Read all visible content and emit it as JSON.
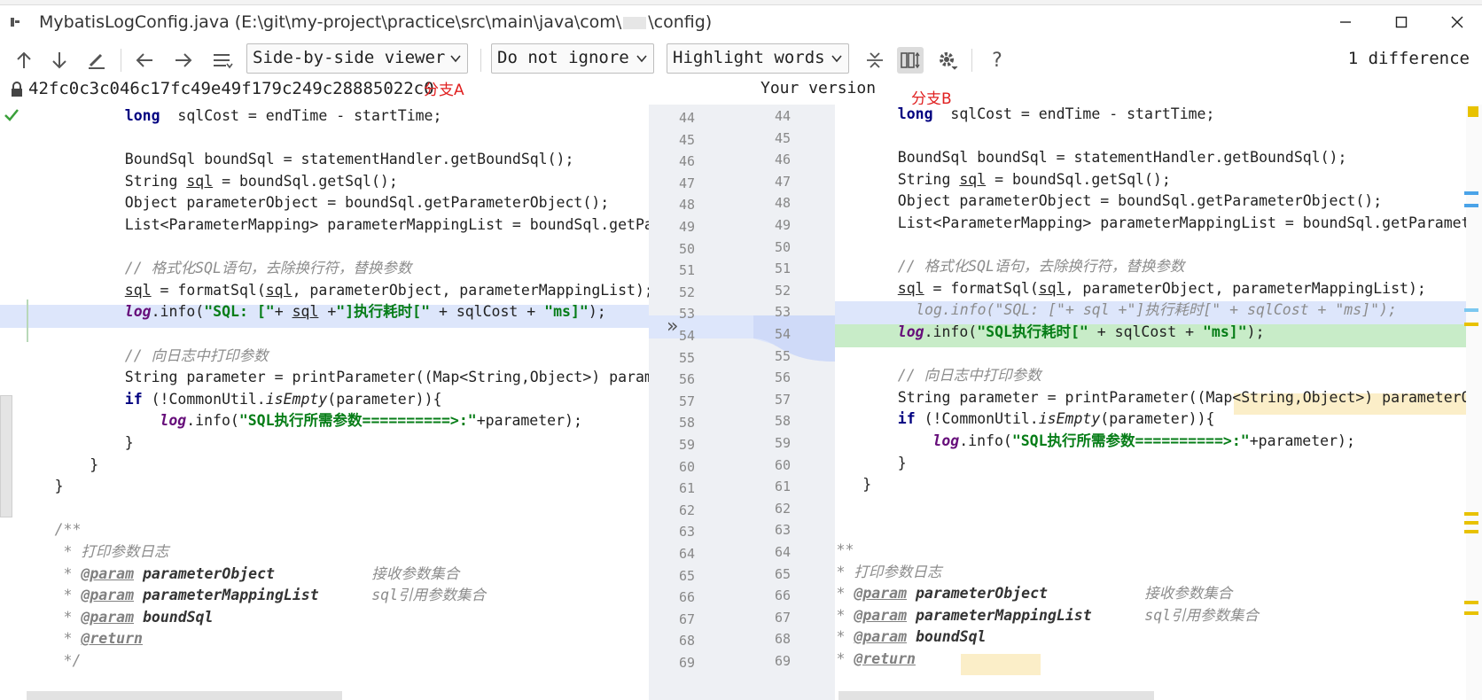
{
  "window": {
    "title": "MybatisLogConfig.java (E:\\git\\my-project\\practice\\src\\main\\java\\com\\",
    "title_tail": "\\config)",
    "minimize": "─",
    "maximize": "☐",
    "close": "✕"
  },
  "toolbar": {
    "viewer_mode": "Side-by-side viewer",
    "ignore_mode": "Do not ignore",
    "highlight_mode": "Highlight words",
    "help": "?",
    "difference_count": "1 difference"
  },
  "header": {
    "left_revision": "42fc0c3c046c17fc49e49f179c249c28885022c0",
    "left_annotation": "分支A",
    "right_title": "Your version",
    "right_annotation": "分支B"
  },
  "gutter_arrow": "»",
  "left_lines": [
    {
      "num": "44",
      "segs": [
        [
          "kw",
          "long"
        ],
        [
          "",
          "  sqlCost = endTime - startTime;"
        ]
      ],
      "ind": 12
    },
    {
      "num": "45",
      "segs": [],
      "ind": 12
    },
    {
      "num": "46",
      "segs": [
        [
          "",
          "BoundSql boundSql = statementHandler.getBoundSql();"
        ]
      ],
      "ind": 12
    },
    {
      "num": "47",
      "segs": [
        [
          "",
          "String "
        ],
        [
          "ul",
          "sql"
        ],
        [
          "",
          " = boundSql.getSql();"
        ]
      ],
      "ind": 12
    },
    {
      "num": "48",
      "segs": [
        [
          "",
          "Object parameterObject = boundSql.getParameterObject();"
        ]
      ],
      "ind": 12
    },
    {
      "num": "49",
      "segs": [
        [
          "",
          "List<ParameterMapping> parameterMappingList = boundSql.getParameterMappings();"
        ]
      ],
      "ind": 12
    },
    {
      "num": "50",
      "segs": [],
      "ind": 12
    },
    {
      "num": "51",
      "segs": [
        [
          "cm",
          "// 格式化SQL语句，去除换行符，替换参数"
        ]
      ],
      "ind": 12
    },
    {
      "num": "52",
      "segs": [
        [
          "ul",
          "sql"
        ],
        [
          "",
          " = formatSql("
        ],
        [
          "ul",
          "sql"
        ],
        [
          "",
          ", parameterObject, parameterMappingList);"
        ]
      ],
      "ind": 12
    },
    {
      "num": "53",
      "segs": [
        [
          "lg",
          "log"
        ],
        [
          "",
          ".info("
        ],
        [
          "str",
          "\"SQL: [\""
        ],
        [
          "",
          "+ "
        ],
        [
          "ul",
          "sql"
        ],
        [
          "",
          " +"
        ],
        [
          "str",
          "\"]执行耗时[\""
        ],
        [
          "",
          " + sqlCost + "
        ],
        [
          "str",
          "\"ms]\""
        ],
        [
          "",
          ");"
        ]
      ],
      "ind": 12
    },
    {
      "num": "54",
      "segs": [],
      "ind": 12
    },
    {
      "num": "55",
      "segs": [
        [
          "cm",
          "// 向日志中打印参数"
        ]
      ],
      "ind": 12
    },
    {
      "num": "56",
      "segs": [
        [
          "",
          "String parameter = printParameter((Map<String,Object>) parameterObject, parameterMappingList, boundSql);"
        ]
      ],
      "ind": 12
    },
    {
      "num": "57",
      "segs": [
        [
          "kw",
          "if"
        ],
        [
          "",
          " (!CommonUtil."
        ],
        [
          "st",
          "isEmpty"
        ],
        [
          "",
          "(parameter)){"
        ]
      ],
      "ind": 12
    },
    {
      "num": "58",
      "segs": [
        [
          "lg",
          "log"
        ],
        [
          "",
          ".info("
        ],
        [
          "str",
          "\"SQL执行所需参数==========>:\""
        ],
        [
          "",
          "+parameter);"
        ]
      ],
      "ind": 16
    },
    {
      "num": "59",
      "segs": [
        [
          "",
          "}"
        ]
      ],
      "ind": 12
    },
    {
      "num": "60",
      "segs": [
        [
          "",
          "}"
        ]
      ],
      "ind": 8
    },
    {
      "num": "61",
      "segs": [
        [
          "",
          "}"
        ]
      ],
      "ind": 4
    },
    {
      "num": "62",
      "segs": [],
      "ind": 4
    },
    {
      "num": "63",
      "segs": [
        [
          "cm",
          "/**"
        ]
      ],
      "ind": 4
    },
    {
      "num": "64",
      "segs": [
        [
          "cm",
          " * 打印参数日志"
        ]
      ],
      "ind": 4
    },
    {
      "num": "65",
      "segs": [
        [
          "cm",
          " * "
        ],
        [
          "tag",
          "@param"
        ],
        [
          "",
          " "
        ],
        [
          "pname",
          "parameterObject"
        ],
        [
          "cm",
          "           接收参数集合"
        ]
      ],
      "ind": 4
    },
    {
      "num": "66",
      "segs": [
        [
          "cm",
          " * "
        ],
        [
          "tag",
          "@param"
        ],
        [
          "",
          " "
        ],
        [
          "pname",
          "parameterMappingList"
        ],
        [
          "cm",
          "      sql引用参数集合"
        ]
      ],
      "ind": 4
    },
    {
      "num": "67",
      "segs": [
        [
          "cm",
          " * "
        ],
        [
          "tag",
          "@param"
        ],
        [
          "",
          " "
        ],
        [
          "pname",
          "boundSql"
        ]
      ],
      "ind": 4
    },
    {
      "num": "68",
      "segs": [
        [
          "cm",
          " * "
        ],
        [
          "tag",
          "@return"
        ]
      ],
      "ind": 4
    },
    {
      "num": "69",
      "segs": [
        [
          "cm",
          " */"
        ]
      ],
      "ind": 4
    }
  ],
  "right_lines": [
    {
      "num": "44",
      "segs": [
        [
          "kw",
          "long"
        ],
        [
          "",
          "  sqlCost = endTime - startTime;"
        ]
      ],
      "ind": 12
    },
    {
      "num": "45",
      "segs": [],
      "ind": 12
    },
    {
      "num": "46",
      "segs": [
        [
          "",
          "BoundSql boundSql = statementHandler.getBoundSql();"
        ]
      ],
      "ind": 12
    },
    {
      "num": "47",
      "segs": [
        [
          "",
          "String "
        ],
        [
          "ul",
          "sql"
        ],
        [
          "",
          " = boundSql.getSql();"
        ]
      ],
      "ind": 12
    },
    {
      "num": "48",
      "segs": [
        [
          "",
          "Object parameterObject = boundSql.getParameterObject();"
        ]
      ],
      "ind": 12
    },
    {
      "num": "49",
      "segs": [
        [
          "",
          "List<ParameterMapping> parameterMappingList = boundSql.getParameterMappings();"
        ]
      ],
      "ind": 12
    },
    {
      "num": "50",
      "segs": [],
      "ind": 12
    },
    {
      "num": "51",
      "segs": [
        [
          "cm",
          "// 格式化SQL语句，去除换行符，替换参数"
        ]
      ],
      "ind": 12
    },
    {
      "num": "52",
      "segs": [
        [
          "ul",
          "sql"
        ],
        [
          "",
          " = formatSql("
        ],
        [
          "ul",
          "sql"
        ],
        [
          "",
          ", parameterObject, parameterMappingList);"
        ]
      ],
      "ind": 12
    },
    {
      "num": "53",
      "segs": [
        [
          "cm",
          "//            log.info(\"SQL: [\"+ sql +\"]执行耗时[\" + sqlCost + \"ms]\");"
        ]
      ],
      "ind": 0
    },
    {
      "num": "54",
      "segs": [
        [
          "lg",
          "log"
        ],
        [
          "",
          ".info("
        ],
        [
          "str",
          "\"SQL执行耗时[\""
        ],
        [
          "",
          " + sqlCost + "
        ],
        [
          "str",
          "\"ms]\""
        ],
        [
          "",
          ");"
        ]
      ],
      "ind": 12
    },
    {
      "num": "55",
      "segs": [],
      "ind": 12
    },
    {
      "num": "56",
      "segs": [
        [
          "cm",
          "// 向日志中打印参数"
        ]
      ],
      "ind": 12
    },
    {
      "num": "57",
      "segs": [
        [
          "",
          "String parameter = printParameter((Map<String,Object>) parameterObject, parameterMappingList, boundSql);"
        ]
      ],
      "ind": 12
    },
    {
      "num": "58",
      "segs": [
        [
          "kw",
          "if"
        ],
        [
          "",
          " (!CommonUtil."
        ],
        [
          "st",
          "isEmpty"
        ],
        [
          "",
          "(parameter)){"
        ]
      ],
      "ind": 12
    },
    {
      "num": "59",
      "segs": [
        [
          "lg",
          "log"
        ],
        [
          "",
          ".info("
        ],
        [
          "str",
          "\"SQL执行所需参数==========>:\""
        ],
        [
          "",
          "+parameter);"
        ]
      ],
      "ind": 16
    },
    {
      "num": "60",
      "segs": [
        [
          "",
          "}"
        ]
      ],
      "ind": 12
    },
    {
      "num": "61",
      "segs": [
        [
          "",
          "}"
        ]
      ],
      "ind": 8
    },
    {
      "num": "62",
      "segs": [
        [
          "",
          "}"
        ]
      ],
      "ind": 4
    },
    {
      "num": "63",
      "segs": [],
      "ind": 4
    },
    {
      "num": "64",
      "segs": [
        [
          "cm",
          "/**"
        ]
      ],
      "ind": 4
    },
    {
      "num": "65",
      "segs": [
        [
          "cm",
          " * 打印参数日志"
        ]
      ],
      "ind": 4
    },
    {
      "num": "66",
      "segs": [
        [
          "cm",
          " * "
        ],
        [
          "tag",
          "@param"
        ],
        [
          "",
          " "
        ],
        [
          "pname",
          "parameterObject"
        ],
        [
          "cm",
          "           接收参数集合"
        ]
      ],
      "ind": 4
    },
    {
      "num": "67",
      "segs": [
        [
          "cm",
          " * "
        ],
        [
          "tag",
          "@param"
        ],
        [
          "",
          " "
        ],
        [
          "pname",
          "parameterMappingList"
        ],
        [
          "cm",
          "      sql引用参数集合"
        ]
      ],
      "ind": 4
    },
    {
      "num": "68",
      "segs": [
        [
          "cm",
          " * "
        ],
        [
          "tag",
          "@param"
        ],
        [
          "",
          " "
        ],
        [
          "pname",
          "boundSql"
        ]
      ],
      "ind": 4
    },
    {
      "num": "69",
      "segs": [
        [
          "cm",
          " * "
        ],
        [
          "tag",
          "@return"
        ]
      ],
      "ind": 4
    }
  ],
  "colors": {
    "changed_bg": "#dde6fb",
    "added_bg": "#c8ecc8",
    "gutter_bg": "#eef0f4",
    "annotation_red": "#e02020"
  }
}
